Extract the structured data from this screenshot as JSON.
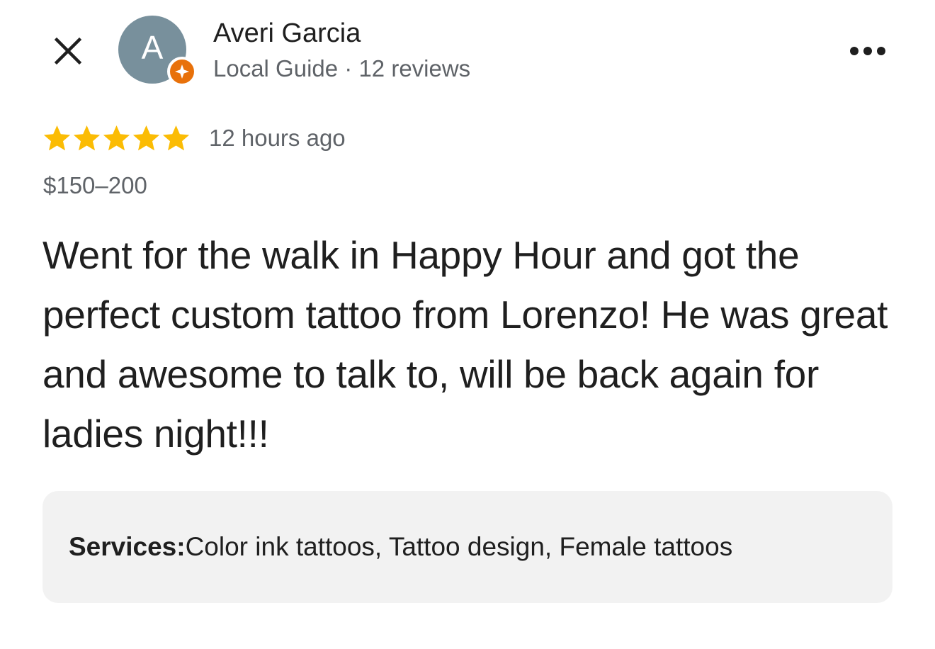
{
  "header": {
    "avatar_letter": "A",
    "reviewer_name": "Averi Garcia",
    "reviewer_role": "Local Guide",
    "meta_separator": " · ",
    "review_count": "12 reviews"
  },
  "review": {
    "rating": 5,
    "rating_max": 5,
    "time_ago": "12 hours ago",
    "price": "$150–200",
    "text": "Went for the walk in Happy Hour and got the perfect custom tattoo from Lorenzo! He was great and awesome to talk to, will be back again for ladies night!!!"
  },
  "services": {
    "label": "Services:",
    "value": " Color ink tattoos, Tattoo design, Female tattoos"
  },
  "icons": {
    "close": "close-icon",
    "more": "more-options-icon",
    "badge": "local-guide-star-icon",
    "star": "star-icon"
  },
  "colors": {
    "avatar_bg": "#78909c",
    "badge_bg": "#e8710a",
    "star": "#fbbc04",
    "text_primary": "#1f1f1f",
    "text_secondary": "#5f6368",
    "services_bg": "#f2f2f2"
  }
}
